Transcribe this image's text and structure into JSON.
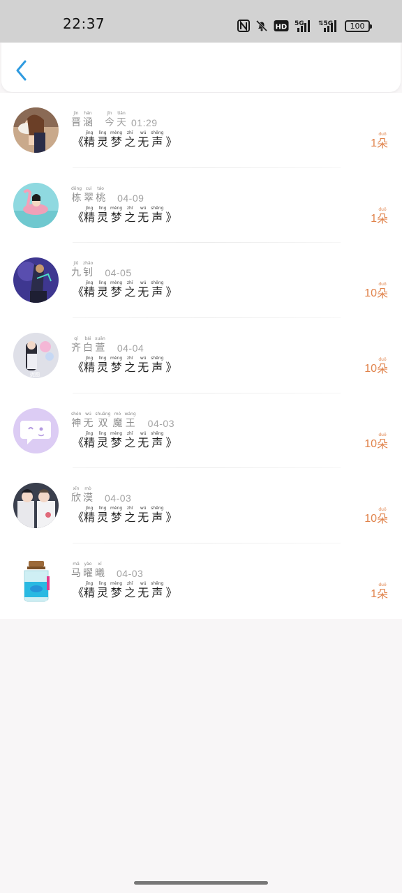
{
  "status_bar": {
    "time": "22:37",
    "icons": [
      "nfc-icon",
      "bell-muted-icon",
      "hd-icon",
      "signal-5g-icon",
      "signal-5g-icon"
    ],
    "battery": "100"
  },
  "header": {
    "back_icon": "chevron-left-icon",
    "accent": "#2f9be0"
  },
  "gift_name": {
    "open": "《",
    "close": "》",
    "chars": [
      {
        "py": "jīng",
        "hz": "精"
      },
      {
        "py": "líng",
        "hz": "灵"
      },
      {
        "py": "mèng",
        "hz": "梦"
      },
      {
        "py": "zhī",
        "hz": "之"
      },
      {
        "py": "wú",
        "hz": "无"
      },
      {
        "py": "shēng",
        "hz": "声"
      }
    ]
  },
  "unit": {
    "py": "duǒ",
    "hz": "朵"
  },
  "records": [
    {
      "name": [
        {
          "py": "jìn",
          "hz": "晋"
        },
        {
          "py": "hán",
          "hz": "涵"
        }
      ],
      "date_ruby": [
        {
          "py": "jīn",
          "hz": "今"
        },
        {
          "py": "tiān",
          "hz": "天"
        }
      ],
      "time": "01:29",
      "count": "1"
    },
    {
      "name": [
        {
          "py": "dōng",
          "hz": "栋"
        },
        {
          "py": "cuì",
          "hz": "翠"
        },
        {
          "py": "táo",
          "hz": "桃"
        }
      ],
      "date_ruby": [],
      "time": "04-09",
      "count": "1"
    },
    {
      "name": [
        {
          "py": "jiǔ",
          "hz": "九"
        },
        {
          "py": "zhāo",
          "hz": "钊"
        }
      ],
      "date_ruby": [],
      "time": "04-05",
      "count": "10"
    },
    {
      "name": [
        {
          "py": "qí",
          "hz": "齐"
        },
        {
          "py": "bái",
          "hz": "白"
        },
        {
          "py": "xuān",
          "hz": "萱"
        }
      ],
      "date_ruby": [],
      "time": "04-04",
      "count": "10"
    },
    {
      "name": [
        {
          "py": "shén",
          "hz": "神"
        },
        {
          "py": "wú",
          "hz": "无"
        },
        {
          "py": "shuāng",
          "hz": "双"
        },
        {
          "py": "mó",
          "hz": "魔"
        },
        {
          "py": "wáng",
          "hz": "王"
        }
      ],
      "date_ruby": [],
      "time": "04-03",
      "count": "10"
    },
    {
      "name": [
        {
          "py": "xīn",
          "hz": "欣"
        },
        {
          "py": "mò",
          "hz": "漠"
        }
      ],
      "date_ruby": [],
      "time": "04-03",
      "count": "10"
    },
    {
      "name": [
        {
          "py": "mǎ",
          "hz": "马"
        },
        {
          "py": "yào",
          "hz": "曜"
        },
        {
          "py": "xī",
          "hz": "曦"
        }
      ],
      "date_ruby": [],
      "time": "04-03",
      "count": "1"
    }
  ]
}
